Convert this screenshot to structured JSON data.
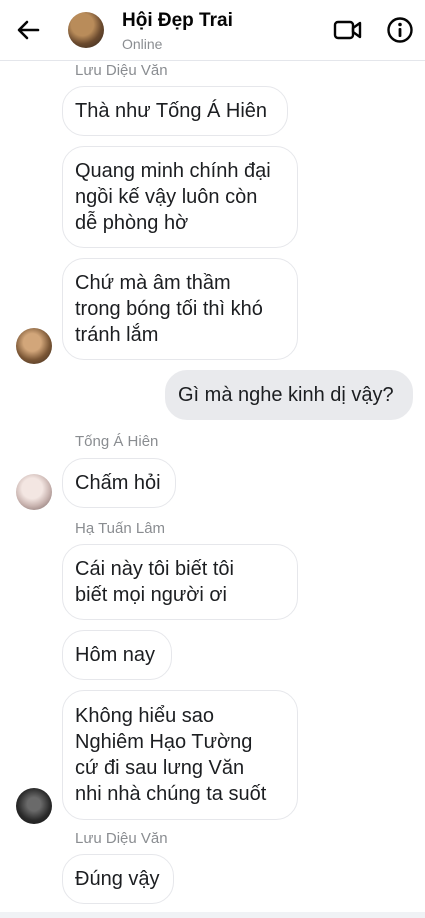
{
  "header": {
    "title": "Hội Đẹp Trai",
    "status": "Online",
    "back_icon": "arrow-left-icon",
    "video_icon": "video-camera-icon",
    "info_icon": "info-icon"
  },
  "messages": {
    "sender1": "Lưu Diệu Văn",
    "m1": "Thà như Tống Á Hiên",
    "m2": "Quang minh chính đại\nngồi kế vậy luôn còn\ndễ phòng hờ",
    "m3": "Chứ mà âm thầm\ntrong bóng tối thì khó\ntránh lắm",
    "out1": "Gì mà nghe kinh dị vậy?",
    "sender2": "Tống Á Hiên",
    "m4": "Chấm hỏi",
    "sender3": "Hạ Tuấn Lâm",
    "m5": "Cái này tôi biết tôi\nbiết mọi người ơi",
    "m6": "Hôm nay",
    "m7": "Không hiểu sao\nNghiêm Hạo Tường\ncứ đi sau lưng Văn\nnhi nhà chúng ta suốt",
    "sender4": "Lưu Diệu Văn",
    "m8": "Đúng vậy"
  },
  "colors": {
    "incoming_bubble": "#ffffff",
    "outgoing_bubble": "#e9eaed",
    "secondary_text": "#8a8d91"
  }
}
